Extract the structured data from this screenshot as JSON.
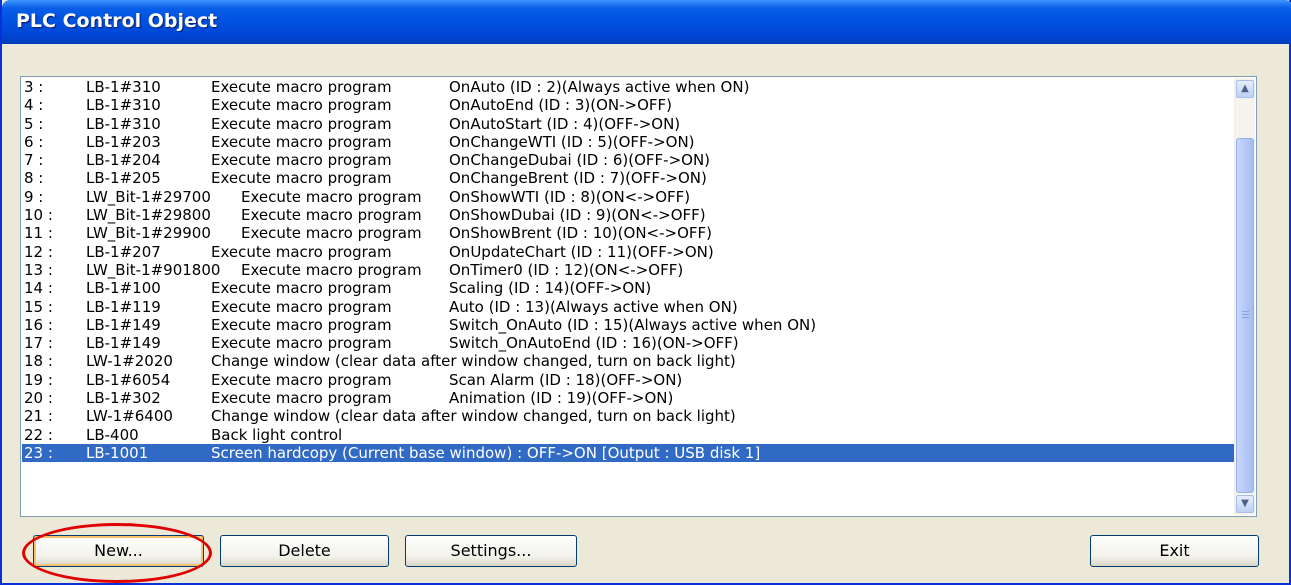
{
  "window": {
    "title": "PLC Control Object"
  },
  "rows": [
    {
      "num": "3 :",
      "addr": "LB-1#310",
      "action": "Execute macro program",
      "detail": "OnAuto (ID : 2)(Always active when ON)"
    },
    {
      "num": "4 :",
      "addr": "LB-1#310",
      "action": "Execute macro program",
      "detail": "OnAutoEnd (ID : 3)(ON->OFF)"
    },
    {
      "num": "5 :",
      "addr": "LB-1#310",
      "action": "Execute macro program",
      "detail": "OnAutoStart (ID : 4)(OFF->ON)"
    },
    {
      "num": "6 :",
      "addr": "LB-1#203",
      "action": "Execute macro program",
      "detail": "OnChangeWTI (ID : 5)(OFF->ON)"
    },
    {
      "num": "7 :",
      "addr": "LB-1#204",
      "action": "Execute macro program",
      "detail": "OnChangeDubai (ID : 6)(OFF->ON)"
    },
    {
      "num": "8 :",
      "addr": "LB-1#205",
      "action": "Execute macro program",
      "detail": "OnChangeBrent (ID : 7)(OFF->ON)"
    },
    {
      "num": "9 :",
      "addr": "LW_Bit-1#29700",
      "action": "Execute macro program",
      "detail": "OnShowWTI (ID : 8)(ON<->OFF)",
      "wide": true
    },
    {
      "num": "10 :",
      "addr": "LW_Bit-1#29800",
      "action": "Execute macro program",
      "detail": "OnShowDubai (ID : 9)(ON<->OFF)",
      "wide": true
    },
    {
      "num": "11 :",
      "addr": "LW_Bit-1#29900",
      "action": "Execute macro program",
      "detail": "OnShowBrent (ID : 10)(ON<->OFF)",
      "wide": true
    },
    {
      "num": "12 :",
      "addr": "LB-1#207",
      "action": "Execute macro program",
      "detail": "OnUpdateChart (ID : 11)(OFF->ON)"
    },
    {
      "num": "13 :",
      "addr": "LW_Bit-1#901800",
      "action": "Execute macro program",
      "detail": "OnTimer0 (ID : 12)(ON<->OFF)",
      "wide": true
    },
    {
      "num": "14 :",
      "addr": "LB-1#100",
      "action": "Execute macro program",
      "detail": "Scaling (ID : 14)(OFF->ON)"
    },
    {
      "num": "15 :",
      "addr": "LB-1#119",
      "action": "Execute macro program",
      "detail": "Auto (ID : 13)(Always active when ON)"
    },
    {
      "num": "16 :",
      "addr": "LB-1#149",
      "action": "Execute macro program",
      "detail": "Switch_OnAuto (ID : 15)(Always active when ON)"
    },
    {
      "num": "17 :",
      "addr": "LB-1#149",
      "action": "Execute macro program",
      "detail": "Switch_OnAutoEnd (ID : 16)(ON->OFF)"
    },
    {
      "num": "18 :",
      "addr": "LW-1#2020",
      "action": "Change window (clear data after window changed, turn on back light)",
      "detail": ""
    },
    {
      "num": "19 :",
      "addr": "LB-1#6054",
      "action": "Execute macro program",
      "detail": "Scan Alarm (ID : 18)(OFF->ON)"
    },
    {
      "num": "20 :",
      "addr": "LB-1#302",
      "action": "Execute macro program",
      "detail": "Animation (ID : 19)(OFF->ON)"
    },
    {
      "num": "21 :",
      "addr": "LW-1#6400",
      "action": "Change window (clear data after window changed, turn on back light)",
      "detail": ""
    },
    {
      "num": "22 :",
      "addr": "LB-400",
      "action": "Back light control",
      "detail": ""
    },
    {
      "num": "23 :",
      "addr": "LB-1001",
      "action": "Screen hardcopy (Current base window) : OFF->ON [Output : USB disk 1]",
      "detail": "",
      "selected": true
    }
  ],
  "scrollbar": {
    "up_icon": "triangle-up",
    "down_icon": "triangle-down"
  },
  "buttons": {
    "new": "New...",
    "delete": "Delete",
    "settings": "Settings...",
    "exit": "Exit"
  },
  "colors": {
    "titlebar": "#0054e3",
    "selection": "#316ac5",
    "annotation": "#e00000"
  }
}
